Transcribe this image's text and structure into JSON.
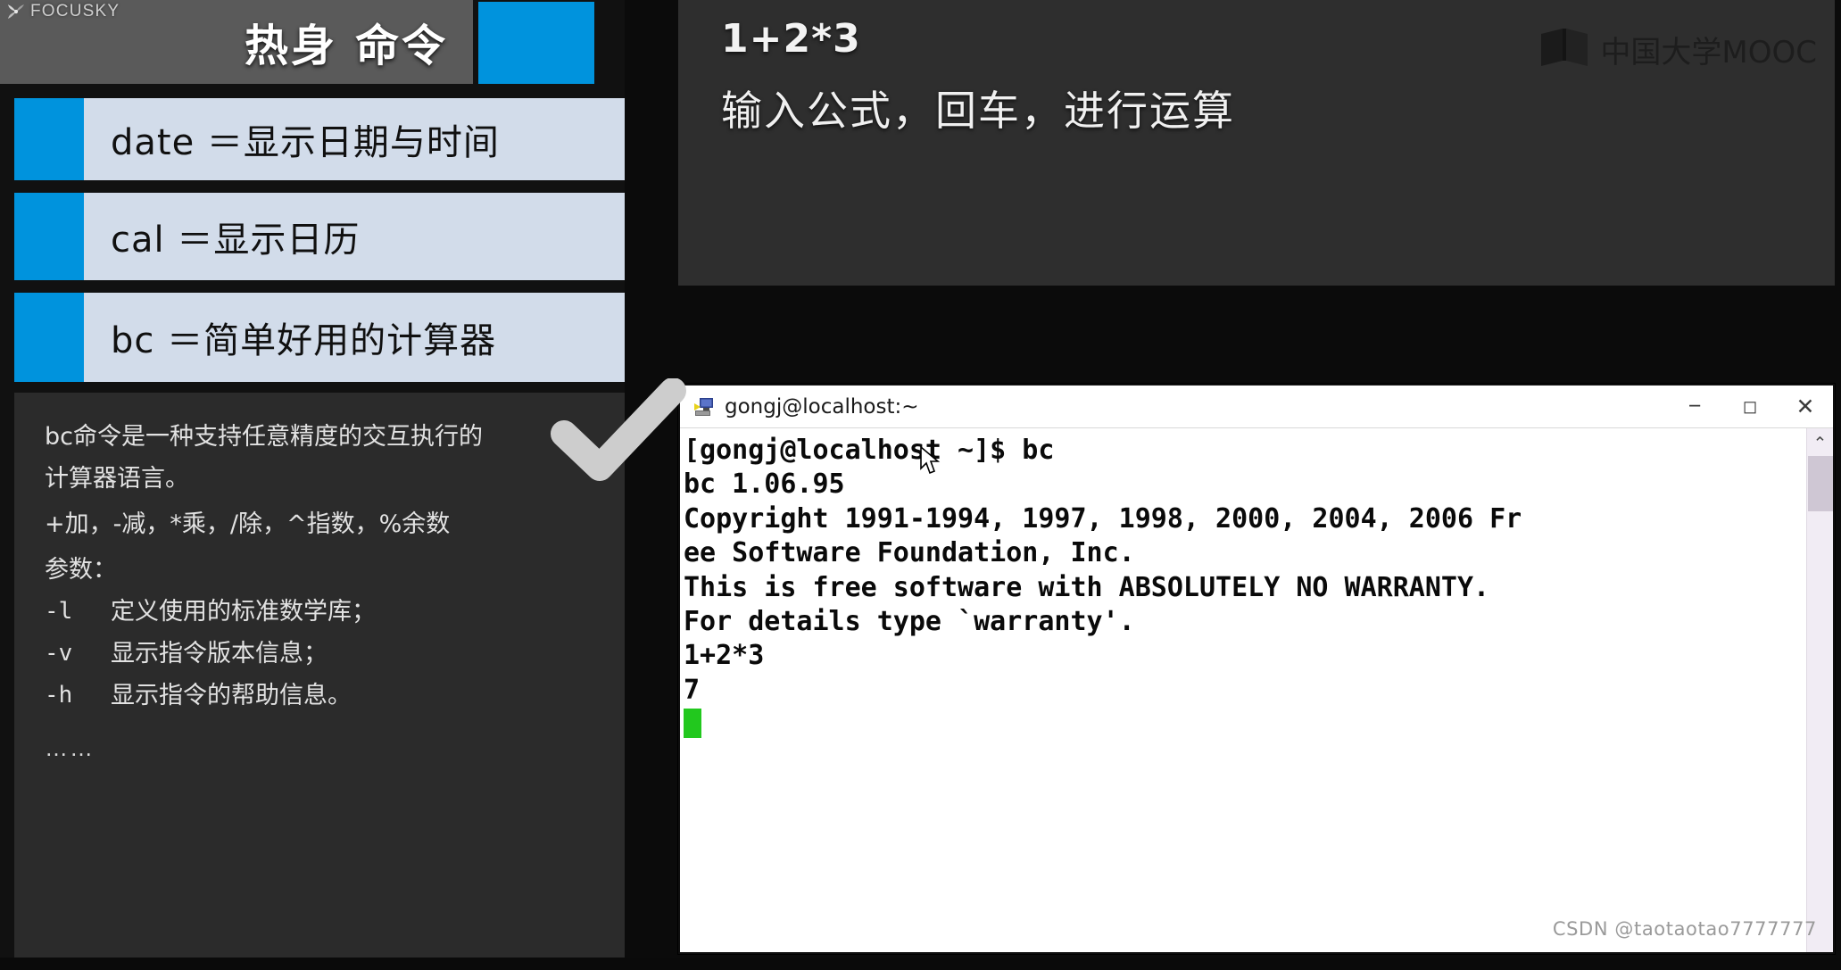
{
  "left_panel": {
    "brand": {
      "name": "FOCUSKY",
      "icon": "focusky-logo-icon"
    },
    "slide_title": "热身 命令",
    "command_rows": [
      {
        "label": "date ＝显示日期与时间"
      },
      {
        "label": "cal ＝显示日历"
      },
      {
        "label": "bc ＝简单好用的计算器"
      }
    ],
    "checkmark_icon": "check-icon",
    "description": {
      "paragraph": [
        "bc命令是一种支持任意精度的交互执行的",
        "计算器语言。"
      ],
      "operators": "+加，-减，*乘，/除，^指数，%余数",
      "params_heading": "参数：",
      "options": [
        {
          "flag": "-l",
          "text": "定义使用的标准数学库；"
        },
        {
          "flag": "-v",
          "text": "显示指令版本信息；"
        },
        {
          "flag": "-h",
          "text": "显示指令的帮助信息。"
        }
      ],
      "ellipsis": "……"
    }
  },
  "right_slide": {
    "expression": "1+2*3",
    "subtitle": "输入公式，回车，进行运算",
    "logo": {
      "text": "中国大学MOOC",
      "icon": "mooc-book-icon"
    }
  },
  "terminal": {
    "title": "gongj@localhost:~",
    "icon": "putty-terminal-icon",
    "window_controls": {
      "minimize": "−",
      "maximize": "◻",
      "close": "✕"
    },
    "scrollbar": {
      "up_arrow": "⌃"
    },
    "lines": [
      "[gongj@localhost ~]$ bc",
      "bc 1.06.95",
      "Copyright 1991-1994, 1997, 1998, 2000, 2004, 2006 Fr",
      "ee Software Foundation, Inc.",
      "This is free software with ABSOLUTELY NO WARRANTY.",
      "For details type `warranty'.",
      "1+2*3",
      "7"
    ],
    "cursor": "block-cursor",
    "cursor_color": "#22c81e"
  },
  "watermark": "CSDN @taotaotao7777777",
  "colors": {
    "accent_blue": "#0093dd",
    "row_bg": "#d2dcea",
    "title_bar_gray": "#5a5a5a",
    "slide_bg": "#2e2e2e",
    "desc_bg": "#2b2b2b",
    "page_bg": "#0b0b0b"
  }
}
